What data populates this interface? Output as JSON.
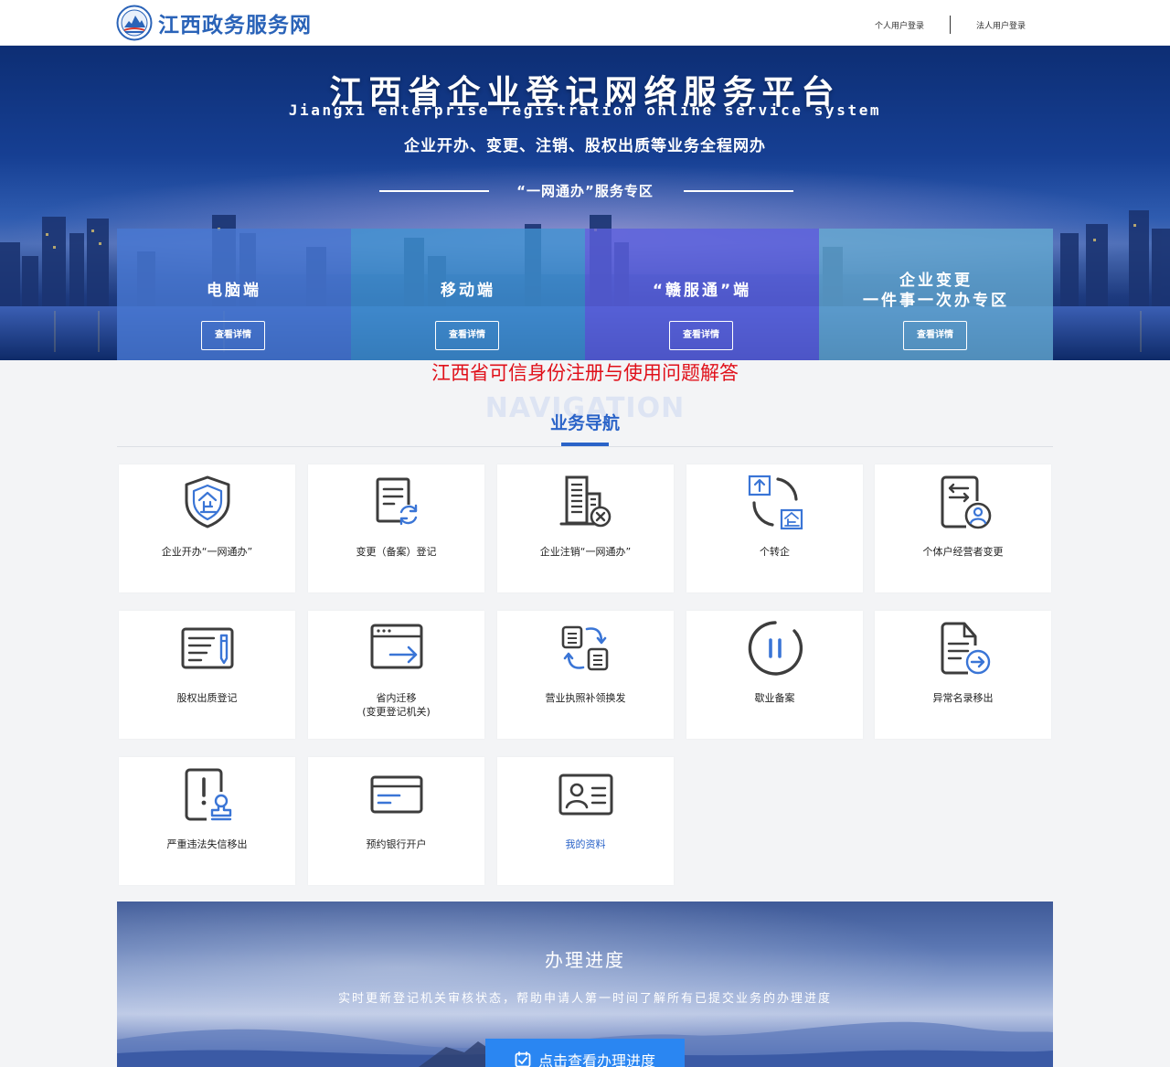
{
  "header": {
    "site_name": "江西政务服务网",
    "personal_login": "个人用户登录",
    "legal_login": "法人用户登录"
  },
  "banner": {
    "title": "江西省企业登记网络服务平台",
    "subtitle_en": "Jiangxi enterprise registration online service system",
    "tagline": "企业开办、变更、注销、股权出质等业务全程网办",
    "zone_title": "“一网通办”服务专区",
    "portals": [
      {
        "title": "电脑端",
        "button": "查看详情"
      },
      {
        "title": "移动端",
        "button": "查看详情"
      },
      {
        "title": "“赣服通”端",
        "button": "查看详情"
      },
      {
        "title_line1": "企业变更",
        "title_line2": "一件事一次办专区",
        "button": "查看详情"
      }
    ]
  },
  "notice": "江西省可信身份注册与使用问题解答",
  "navigation": {
    "watermark": "NAVIGATION",
    "title": "业务导航",
    "items": [
      {
        "label": "企业开办“一网通办”",
        "icon": "enterprise-shield-icon"
      },
      {
        "label": "变更（备案）登记",
        "icon": "document-refresh-icon"
      },
      {
        "label": "企业注销“一网通办”",
        "icon": "building-cancel-icon"
      },
      {
        "label": "个转企",
        "icon": "transfer-arrows-icon"
      },
      {
        "label": "个体户经营者变更",
        "icon": "document-user-icon"
      },
      {
        "label": "股权出质登记",
        "icon": "form-pen-icon"
      },
      {
        "label": "省内迁移",
        "label2": "(变更登记机关)",
        "icon": "window-arrow-icon"
      },
      {
        "label": "营业执照补领换发",
        "icon": "document-swap-icon"
      },
      {
        "label": "歇业备案",
        "icon": "pause-circle-icon"
      },
      {
        "label": "异常名录移出",
        "icon": "document-export-icon"
      },
      {
        "label": "严重违法失信移出",
        "icon": "warning-stamp-icon"
      },
      {
        "label": "预约银行开户",
        "icon": "bank-card-icon"
      },
      {
        "label": "我的资料",
        "icon": "id-card-icon"
      }
    ]
  },
  "progress": {
    "title": "办理进度",
    "description": "实时更新登记机关审核状态，帮助申请人第一时间了解所有已提交业务的办理进度",
    "button": "点击查看办理进度"
  },
  "colors": {
    "brand_blue": "#2a63c8",
    "notice_red": "#e0101a",
    "icon_gray": "#3d3d3d",
    "icon_accent": "#3a75d6"
  }
}
